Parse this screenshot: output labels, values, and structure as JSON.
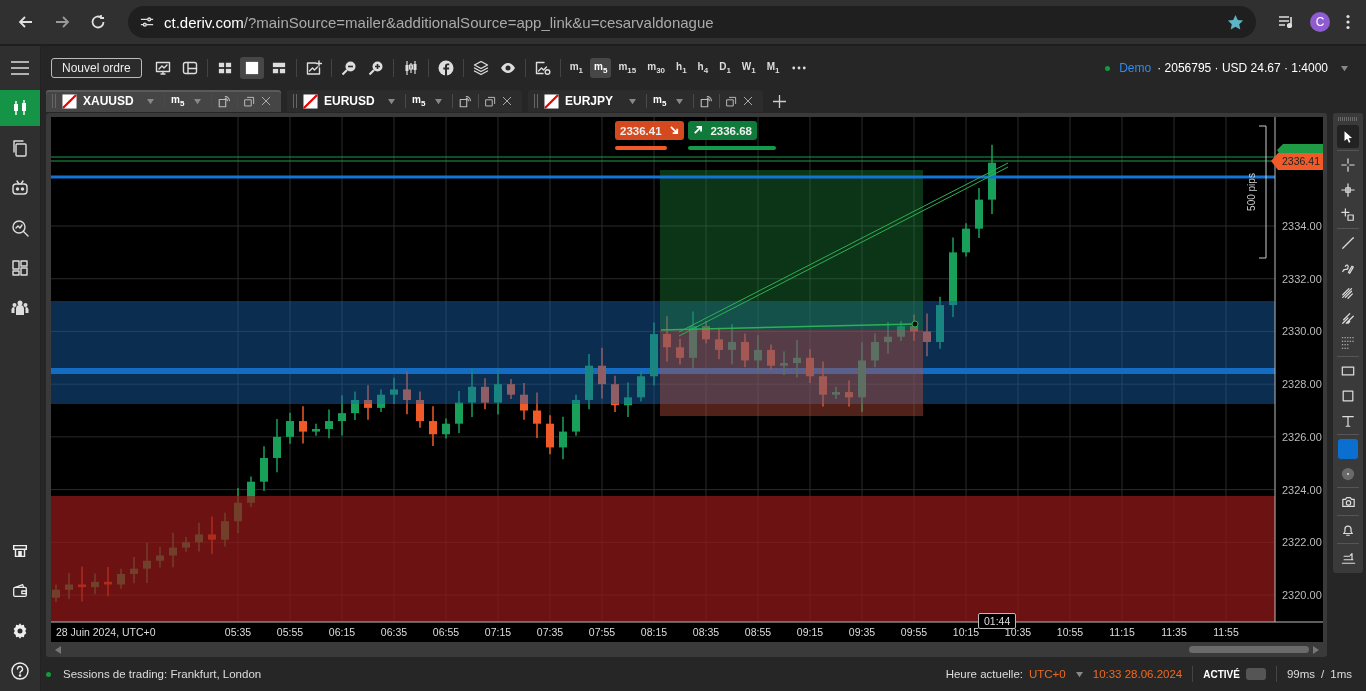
{
  "browser": {
    "url_host": "ct.deriv.com",
    "url_path": "/?mainSource=mailer&additionalSource=app_link&u=cesarvaldonague",
    "profile_initial": "C"
  },
  "sidebar": {
    "items": [
      {
        "selected": true
      },
      {
        "selected": false
      },
      {
        "selected": false
      },
      {
        "selected": false
      },
      {
        "selected": false
      },
      {
        "selected": false
      }
    ]
  },
  "toolbar": {
    "new_order": "Nouvel ordre",
    "layouts": [
      {
        "selected": false
      },
      {
        "selected": true
      },
      {
        "selected": false
      }
    ],
    "timeframes": [
      {
        "label": "m$_{1}$",
        "selected": false
      },
      {
        "label": "m$_{5}$",
        "selected": true
      },
      {
        "label": "m$_{15}$",
        "selected": false
      },
      {
        "label": "m$_{30}$",
        "selected": false
      },
      {
        "label": "h$_{1}$",
        "selected": false
      },
      {
        "label": "h$_{4}$",
        "selected": false
      },
      {
        "label": "D$_{1}$",
        "selected": false
      },
      {
        "label": "W$_{1}$",
        "selected": false
      },
      {
        "label": "M$_{1}$",
        "selected": false
      }
    ]
  },
  "account": {
    "mode": "Demo",
    "details": "· 2056795 · USD 24.67 · 1:4000"
  },
  "tabs": [
    {
      "symbol": "XAUUSD",
      "timeframe": "m$_{5}$",
      "selected": true
    },
    {
      "symbol": "EURUSD",
      "timeframe": "m$_{5}$",
      "selected": false
    },
    {
      "symbol": "EURJPY",
      "timeframe": "m$_{5}$",
      "selected": false
    }
  ],
  "chart": {
    "bid": "2336.41",
    "ask": "2336.68",
    "price_tag": "2336.41",
    "measure_label": "500 pips",
    "timer": "01:44",
    "y_axis": [
      "2334.00",
      "2332.00",
      "2330.00",
      "2328.00",
      "2326.00",
      "2324.00",
      "2322.00",
      "2320.00"
    ],
    "date_label": "28 Juin 2024, UTC+0",
    "x_axis": [
      "05:35",
      "05:55",
      "06:15",
      "06:35",
      "06:55",
      "07:15",
      "07:35",
      "07:55",
      "08:15",
      "08:35",
      "08:55",
      "09:15",
      "09:35",
      "09:55",
      "10:15",
      "10:35",
      "10:55",
      "11:15",
      "11:35",
      "11:55"
    ]
  },
  "tools": [
    {
      "selected": true
    },
    {
      "selected": false
    },
    {
      "selected": false
    },
    {
      "selected": false
    },
    {
      "selected": false
    },
    {
      "selected": false
    },
    {
      "selected": false
    },
    {
      "selected": false
    },
    {
      "selected": false
    },
    {
      "selected": false
    },
    {
      "selected": false
    },
    {
      "selected": false
    },
    {
      "selected": false
    },
    {
      "selected": false
    },
    {
      "selected": false
    },
    {
      "selected": false
    },
    {
      "selected": false
    }
  ],
  "status": {
    "sessions": "Sessions de trading: Frankfurt, London",
    "time_label": "Heure actuelle:",
    "timezone": "UTC+0",
    "datetime": "10:33 28.06.2024",
    "active_label": "ACTIVÉ",
    "active_on": false,
    "ping": "99ms",
    "separator": "/",
    "server": "1ms"
  }
}
